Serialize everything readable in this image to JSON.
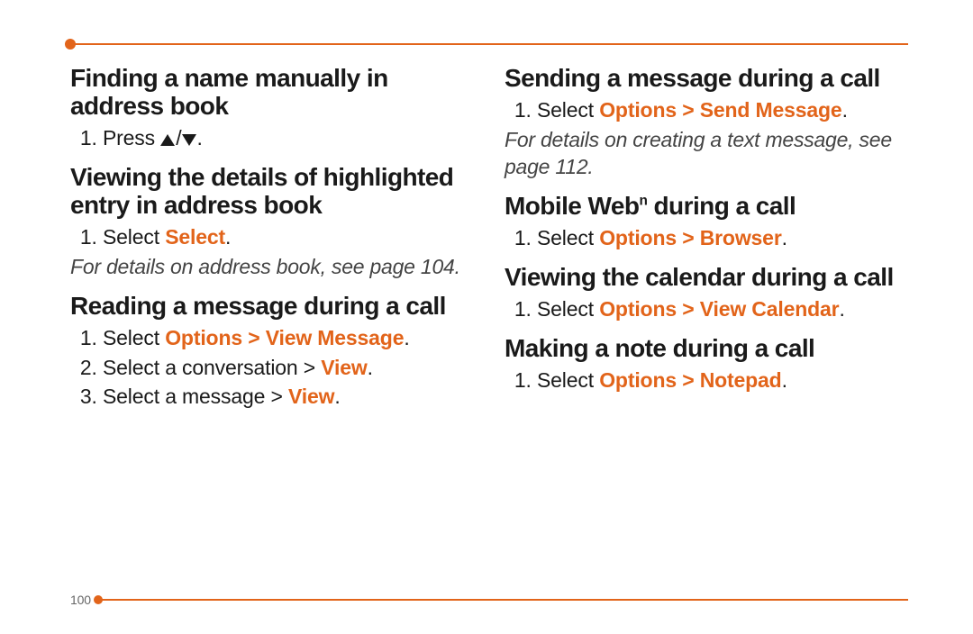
{
  "page_number": "100",
  "accent": "#e2641a",
  "left": {
    "h1": "Finding a name manually in address book",
    "h1_step_prefix": "Press ",
    "h1_step_suffix": ".",
    "h2": "Viewing the details of highlighted entry in address book",
    "h2_step_prefix": "Select ",
    "h2_step_kw": "Select",
    "h2_step_suffix": ".",
    "note1": "For details on address book, see page 104.",
    "h3": "Reading a message during a call",
    "h3_s1_prefix": "Select ",
    "h3_s1_kw": "Options > View Message",
    "h3_s1_suffix": ".",
    "h3_s2_prefix": "Select a conversation > ",
    "h3_s2_kw": "View",
    "h3_s2_suffix": ".",
    "h3_s3_prefix": "Select a message > ",
    "h3_s3_kw": "View",
    "h3_s3_suffix": "."
  },
  "right": {
    "h1": "Sending a message during a call",
    "h1_s1_prefix": "Select ",
    "h1_s1_kw": "Options > Send Message",
    "h1_s1_suffix": ".",
    "note1": "For details on creating a text message, see page 112.",
    "h2_a": "Mobile Web",
    "h2_b": " during a call",
    "h2_sup": "n",
    "h2_s1_prefix": "Select ",
    "h2_s1_kw": "Options > Browser",
    "h2_s1_suffix": ".",
    "h3": "Viewing the calendar during a call",
    "h3_s1_prefix": "Select ",
    "h3_s1_kw": "Options > View Calendar",
    "h3_s1_suffix": ".",
    "h4": "Making a note during a call",
    "h4_s1_prefix": "Select ",
    "h4_s1_kw": "Options > Notepad",
    "h4_s1_suffix": "."
  }
}
